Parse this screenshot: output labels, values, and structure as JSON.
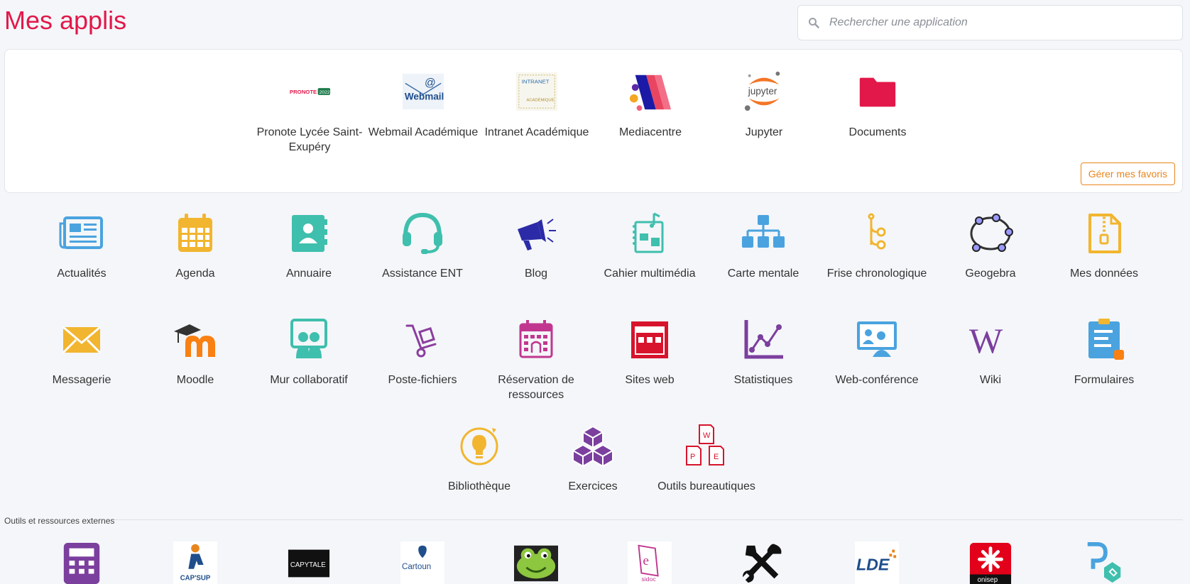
{
  "page": {
    "title": "Mes applis"
  },
  "search": {
    "placeholder": "Rechercher une application"
  },
  "favorites": {
    "manage_label": "Gérer mes favoris",
    "items": [
      {
        "label": "Pronote Lycée Saint-Exupéry",
        "icon": "pronote-icon",
        "logo_text": "PRONOTE",
        "logo_badge": "2022"
      },
      {
        "label": "Webmail Académique",
        "icon": "webmail-icon",
        "logo_text": "Webmail"
      },
      {
        "label": "Intranet Académique",
        "icon": "intranet-icon",
        "logo_text": "INTRANET",
        "logo_sub": "ACADÉMIQUE"
      },
      {
        "label": "Mediacentre",
        "icon": "mediacentre-icon"
      },
      {
        "label": "Jupyter",
        "icon": "jupyter-icon",
        "logo_text": "jupyter"
      },
      {
        "label": "Documents",
        "icon": "folder-icon"
      }
    ]
  },
  "apps": [
    {
      "label": "Actualités",
      "icon": "newspaper-icon",
      "color": "#4aa3df"
    },
    {
      "label": "Agenda",
      "icon": "calendar-icon",
      "color": "#f2b52f"
    },
    {
      "label": "Annuaire",
      "icon": "contact-book-icon",
      "color": "#3fbfad"
    },
    {
      "label": "Assistance ENT",
      "icon": "headset-icon",
      "color": "#3fbfad"
    },
    {
      "label": "Blog",
      "icon": "megaphone-icon",
      "color": "#2b2ba8"
    },
    {
      "label": "Cahier multimédia",
      "icon": "notebook-icon",
      "color": "#3fbfad"
    },
    {
      "label": "Carte mentale",
      "icon": "sitemap-icon",
      "color": "#4aa3df"
    },
    {
      "label": "Frise chronologique",
      "icon": "timeline-icon",
      "color": "#f2b52f"
    },
    {
      "label": "Geogebra",
      "icon": "geogebra-icon",
      "color": "#9999ff"
    },
    {
      "label": "Mes données",
      "icon": "zip-file-icon",
      "color": "#f2b52f"
    },
    {
      "label": "Messagerie",
      "icon": "envelope-icon",
      "color": "#f2b52f"
    },
    {
      "label": "Moodle",
      "icon": "moodle-icon",
      "color": "#f98012"
    },
    {
      "label": "Mur collaboratif",
      "icon": "collab-wall-icon",
      "color": "#3fbfad"
    },
    {
      "label": "Poste-fichiers",
      "icon": "hand-truck-icon",
      "color": "#8b3d9e"
    },
    {
      "label": "Réservation de ressources",
      "icon": "reservation-calendar-icon",
      "color": "#c1378f"
    },
    {
      "label": "Sites web",
      "icon": "website-icon",
      "color": "#d7142c"
    },
    {
      "label": "Statistiques",
      "icon": "chart-icon",
      "color": "#7b3f9e"
    },
    {
      "label": "Web-conférence",
      "icon": "web-conference-icon",
      "color": "#4aa3df"
    },
    {
      "label": "Wiki",
      "icon": "wiki-icon",
      "color": "#7b3f9e"
    },
    {
      "label": "Formulaires",
      "icon": "form-icon",
      "color": "#4aa3df"
    },
    {
      "label": "Bibliothèque",
      "icon": "lightbulb-icon",
      "color": "#f2b52f"
    },
    {
      "label": "Exercices",
      "icon": "cubes-icon",
      "color": "#7b3f9e"
    },
    {
      "label": "Outils bureautiques",
      "icon": "office-files-icon",
      "color": "#d7142c"
    }
  ],
  "external": {
    "title": "Outils et ressources externes",
    "items": [
      {
        "icon": "calculator-icon"
      },
      {
        "icon": "capsup-icon",
        "logo_text": "CAP'SUP"
      },
      {
        "icon": "capytale-icon",
        "logo_text": "CAPYTALE"
      },
      {
        "icon": "cartoun-icon",
        "logo_text": "Cartoun"
      },
      {
        "icon": "frog-icon"
      },
      {
        "icon": "esidoc-icon",
        "logo_text": "sidoc"
      },
      {
        "icon": "tools-icon"
      },
      {
        "icon": "lde-icon",
        "logo_text": "LDE"
      },
      {
        "icon": "onisep-icon",
        "logo_text": "onisep"
      },
      {
        "icon": "pix-icon"
      }
    ]
  }
}
